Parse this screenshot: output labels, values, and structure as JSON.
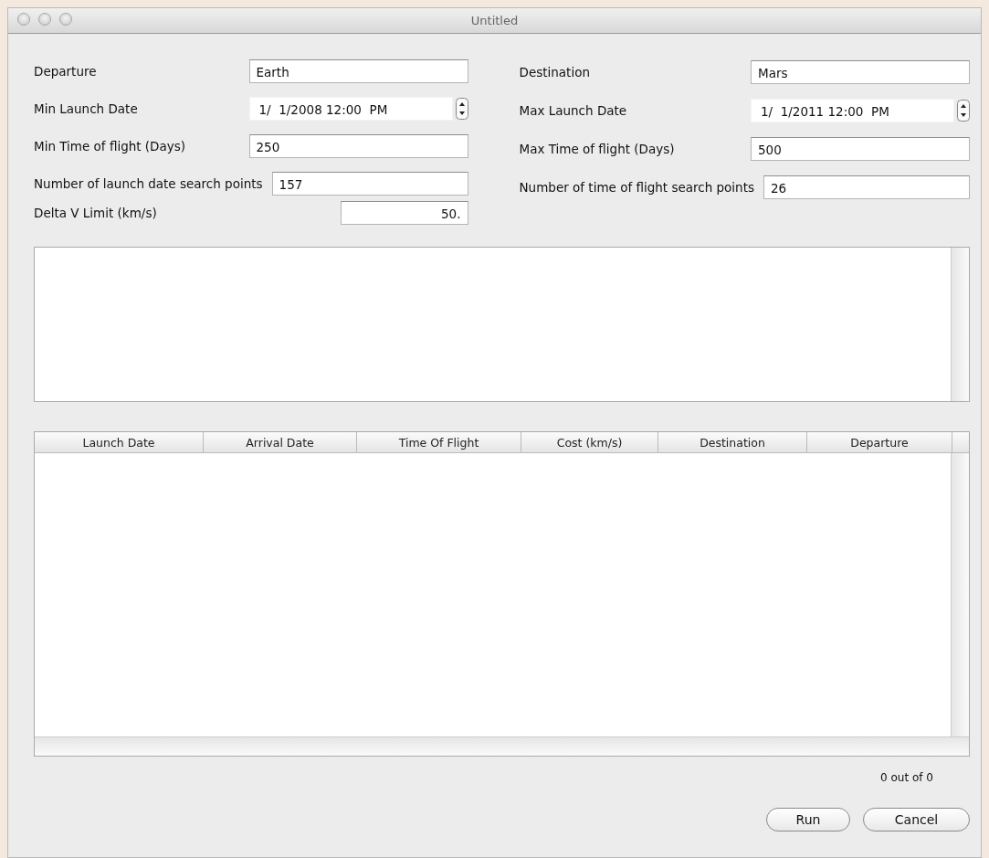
{
  "window": {
    "title": "Untitled"
  },
  "left_fields": [
    {
      "label": "Departure",
      "kind": "text",
      "value": "Earth"
    },
    {
      "label": "Min Launch Date",
      "kind": "date",
      "value": "1/  1/2008 12:00  PM"
    },
    {
      "label": "Min Time of flight (Days)",
      "kind": "text",
      "value": "250"
    },
    {
      "label": "Number of launch date search points",
      "kind": "text",
      "value": "157"
    },
    {
      "label": "Delta V Limit (km/s)",
      "kind": "number",
      "value": "50."
    }
  ],
  "right_fields": [
    {
      "label": "Destination",
      "kind": "text",
      "value": "Mars"
    },
    {
      "label": "Max Launch Date",
      "kind": "date",
      "value": "1/  1/2011 12:00  PM"
    },
    {
      "label": "Max Time of flight (Days)",
      "kind": "text",
      "value": "500"
    },
    {
      "label": "Number of time of flight search points",
      "kind": "text",
      "value": "26"
    }
  ],
  "table": {
    "columns": [
      "Launch Date",
      "Arrival Date",
      "Time Of Flight",
      "Cost (km/s)",
      "Destination",
      "Departure"
    ]
  },
  "status": "0 out of 0",
  "buttons": [
    "Run",
    "Cancel"
  ]
}
